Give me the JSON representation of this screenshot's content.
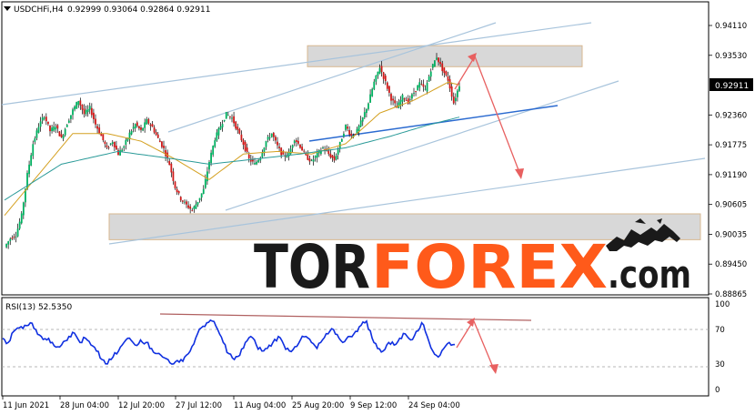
{
  "header": {
    "symbol": "USDCHFi,H4",
    "ohlc": "0.92999 0.93064 0.92864 0.92911"
  },
  "brand": {
    "name_part1": "TOR",
    "name_part2": "FOREX",
    "name_part3": ".com",
    "logo_icon": "bull-bear-icon"
  },
  "colors": {
    "bull": "#00b060",
    "bear": "#d01818",
    "wick": "#000000",
    "ma_fast": "#d4a020",
    "ma_slow": "#2a9a98",
    "channel": "#a8c4dc",
    "channel_blue": "#2a6ad0",
    "zone_fill": "#d8d8d8",
    "zone_border": "#d8b890",
    "arrow": "#e86060",
    "rsi_line": "#1030e0",
    "rsi_trend": "#b06060",
    "brand_dark": "#1a1a1a",
    "brand_orange": "#ff5a1a",
    "price_tag_bg": "#000000"
  },
  "chart_data": [
    {
      "type": "candlestick",
      "instrument": "USDCHFi",
      "timeframe": "H4",
      "current_price": "0.92911",
      "ylim": [
        0.88865,
        0.9411
      ],
      "y_ticks": [
        "0.94110",
        "0.93530",
        "0.92911",
        "0.92360",
        "0.91775",
        "0.91190",
        "0.90605",
        "0.90035",
        "0.89450",
        "0.88865"
      ],
      "x_ticks": [
        "11 Jun 2021",
        "28 Jun 04:00",
        "12 Jul 20:00",
        "27 Jul 12:00",
        "11 Aug 04:00",
        "25 Aug 20:00",
        "9 Sep 12:00",
        "24 Sep 04:00"
      ],
      "price_path": [
        [
          0,
          0.8978
        ],
        [
          1,
          0.8995
        ],
        [
          2,
          0.9002
        ],
        [
          3,
          0.904
        ],
        [
          4,
          0.912
        ],
        [
          5,
          0.918
        ],
        [
          6,
          0.9215
        ],
        [
          7,
          0.9235
        ],
        [
          8,
          0.9205
        ],
        [
          9,
          0.9215
        ],
        [
          10,
          0.919
        ],
        [
          11,
          0.922
        ],
        [
          12,
          0.9245
        ],
        [
          13,
          0.9265
        ],
        [
          14,
          0.9238
        ],
        [
          15,
          0.925
        ],
        [
          16,
          0.9218
        ],
        [
          17,
          0.9195
        ],
        [
          18,
          0.917
        ],
        [
          19,
          0.9185
        ],
        [
          20,
          0.916
        ],
        [
          21,
          0.9175
        ],
        [
          22,
          0.92
        ],
        [
          23,
          0.9218
        ],
        [
          24,
          0.9205
        ],
        [
          25,
          0.9225
        ],
        [
          26,
          0.9212
        ],
        [
          27,
          0.919
        ],
        [
          28,
          0.917
        ],
        [
          29,
          0.914
        ],
        [
          30,
          0.9095
        ],
        [
          31,
          0.9072
        ],
        [
          32,
          0.906
        ],
        [
          33,
          0.905
        ],
        [
          34,
          0.9068
        ],
        [
          35,
          0.909
        ],
        [
          36,
          0.9145
        ],
        [
          37,
          0.919
        ],
        [
          38,
          0.9215
        ],
        [
          39,
          0.9238
        ],
        [
          40,
          0.923
        ],
        [
          41,
          0.9205
        ],
        [
          42,
          0.918
        ],
        [
          43,
          0.915
        ],
        [
          44,
          0.914
        ],
        [
          45,
          0.9155
        ],
        [
          46,
          0.9185
        ],
        [
          47,
          0.92
        ],
        [
          48,
          0.9175
        ],
        [
          49,
          0.9155
        ],
        [
          50,
          0.916
        ],
        [
          51,
          0.919
        ],
        [
          52,
          0.9175
        ],
        [
          53,
          0.9155
        ],
        [
          54,
          0.9145
        ],
        [
          55,
          0.916
        ],
        [
          56,
          0.9172
        ],
        [
          57,
          0.916
        ],
        [
          58,
          0.9148
        ],
        [
          59,
          0.918
        ],
        [
          60,
          0.9215
        ],
        [
          61,
          0.9195
        ],
        [
          62,
          0.9205
        ],
        [
          63,
          0.923
        ],
        [
          64,
          0.926
        ],
        [
          65,
          0.93
        ],
        [
          66,
          0.933
        ],
        [
          67,
          0.93
        ],
        [
          68,
          0.9268
        ],
        [
          69,
          0.925
        ],
        [
          70,
          0.9272
        ],
        [
          71,
          0.9262
        ],
        [
          72,
          0.928
        ],
        [
          73,
          0.9298
        ],
        [
          74,
          0.9285
        ],
        [
          75,
          0.9325
        ],
        [
          76,
          0.935
        ],
        [
          77,
          0.9325
        ],
        [
          78,
          0.9305
        ],
        [
          79,
          0.926
        ],
        [
          80,
          0.9295
        ]
      ],
      "ma_fast": [
        [
          0,
          0.904
        ],
        [
          6,
          0.912
        ],
        [
          12,
          0.92
        ],
        [
          18,
          0.92
        ],
        [
          24,
          0.9185
        ],
        [
          30,
          0.915
        ],
        [
          36,
          0.911
        ],
        [
          42,
          0.916
        ],
        [
          48,
          0.9165
        ],
        [
          54,
          0.916
        ],
        [
          60,
          0.918
        ],
        [
          66,
          0.924
        ],
        [
          72,
          0.9265
        ],
        [
          78,
          0.93
        ],
        [
          80,
          0.9295
        ]
      ],
      "ma_slow": [
        [
          0,
          0.907
        ],
        [
          10,
          0.914
        ],
        [
          20,
          0.9165
        ],
        [
          30,
          0.915
        ],
        [
          36,
          0.914
        ],
        [
          44,
          0.915
        ],
        [
          52,
          0.916
        ],
        [
          60,
          0.9172
        ],
        [
          68,
          0.9195
        ],
        [
          74,
          0.9215
        ],
        [
          80,
          0.9232
        ]
      ],
      "resistance_zone": [
        0.93305,
        0.93715
      ],
      "support_zone": [
        0.89925,
        0.9043
      ]
    },
    {
      "type": "line",
      "indicator": "RSI(13)",
      "value": "52.5350",
      "label": "RSI(13) 52.5350",
      "ylim": [
        0,
        100
      ],
      "y_ticks": [
        "100",
        "70",
        "30",
        "0"
      ],
      "values": [
        60,
        55,
        68,
        72,
        75,
        78,
        70,
        62,
        58,
        55,
        50,
        56,
        62,
        66,
        55,
        60,
        52,
        45,
        35,
        30,
        38,
        45,
        55,
        60,
        52,
        58,
        55,
        48,
        42,
        38,
        35,
        30,
        32,
        38,
        45,
        60,
        72,
        78,
        80,
        70,
        55,
        42,
        35,
        40,
        55,
        62,
        52,
        45,
        48,
        55,
        62,
        52,
        45,
        50,
        58,
        62,
        55,
        48,
        58,
        65,
        70,
        60,
        56,
        62,
        68,
        75,
        80,
        60,
        48,
        45,
        55,
        52,
        60,
        65,
        58,
        68,
        78,
        62,
        45,
        38,
        48,
        55,
        52.5
      ]
    }
  ]
}
